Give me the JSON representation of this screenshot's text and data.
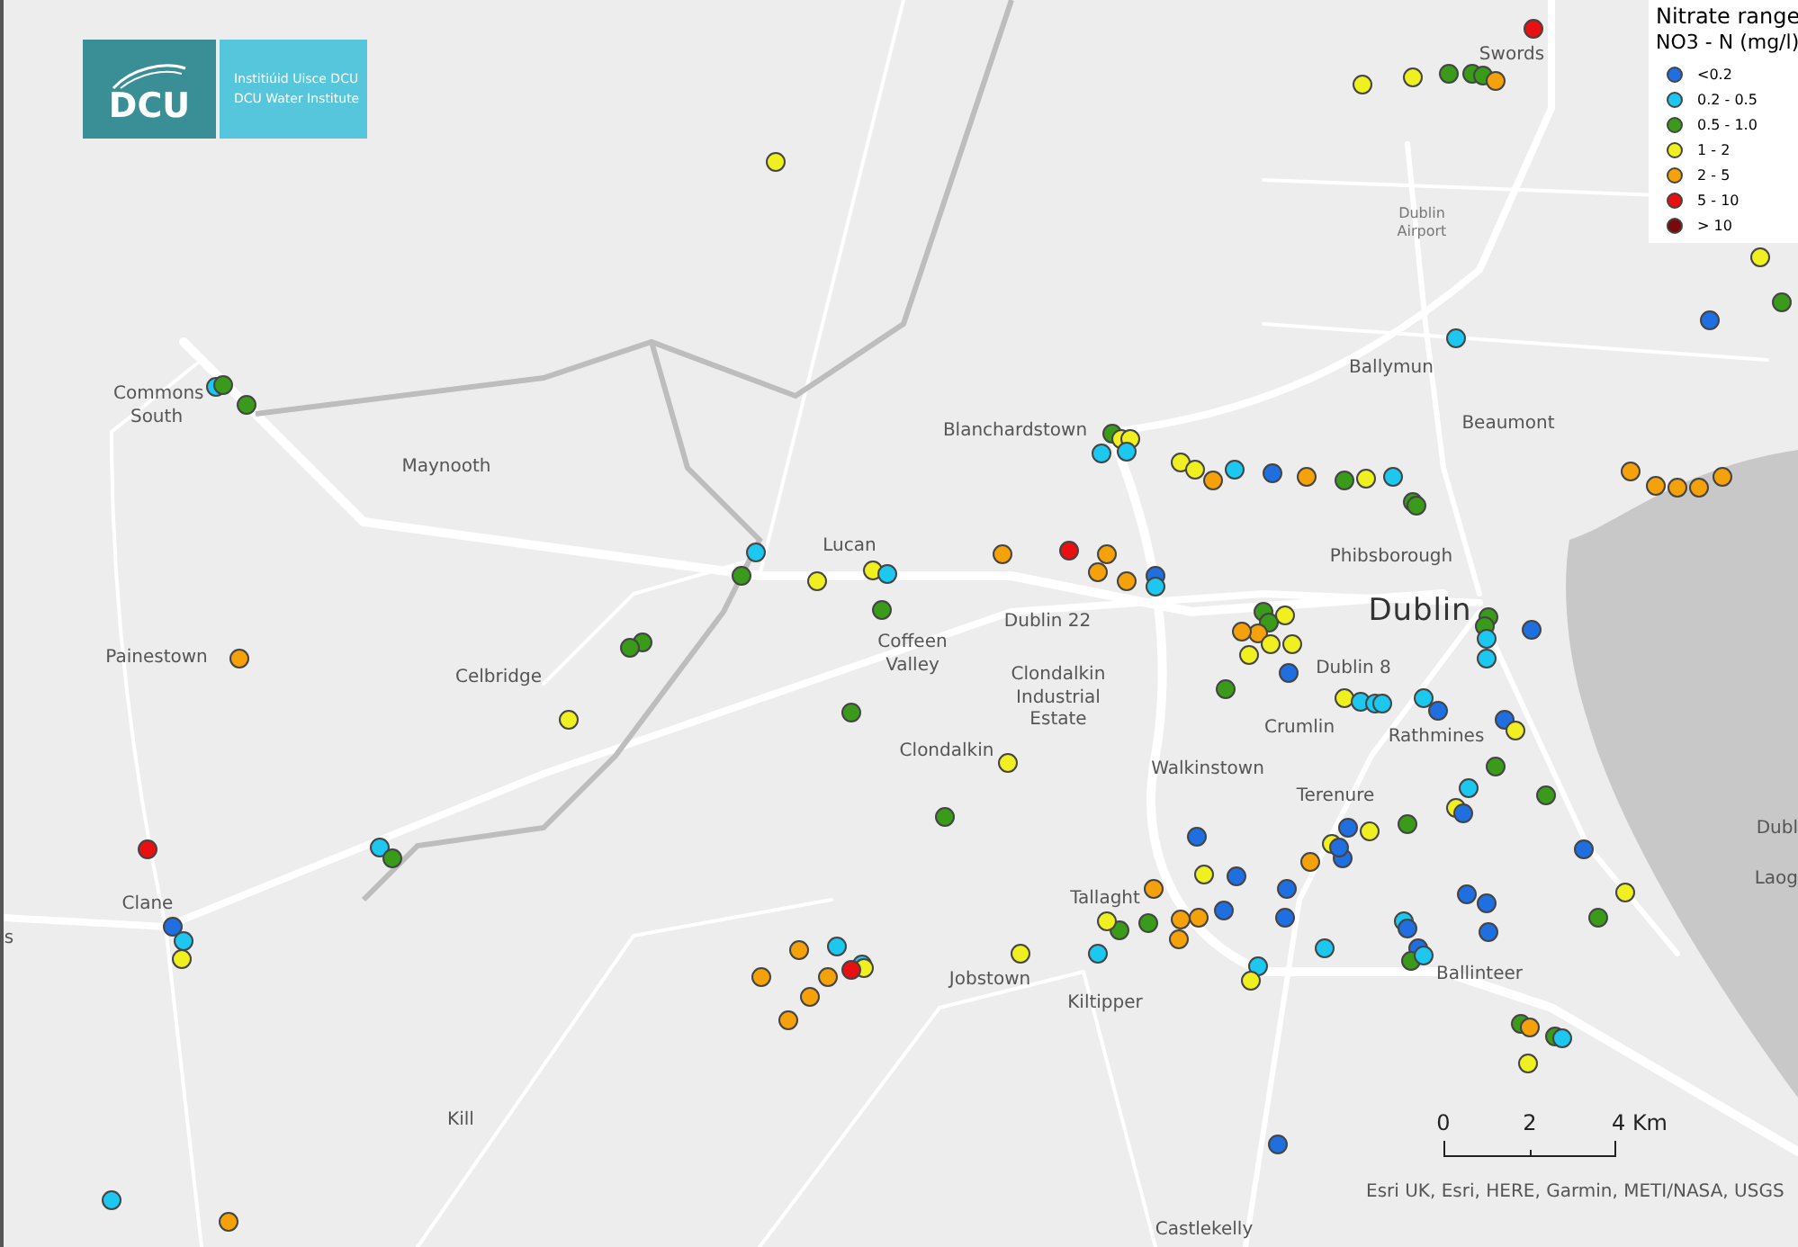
{
  "logo": {
    "mark": "DCU",
    "lines": [
      "Institiúid Uisce DCU",
      "DCU Water Institute"
    ]
  },
  "legend": {
    "title": "Nitrate range",
    "subtitle": "NO3 - N (mg/l)",
    "classes": [
      {
        "label": "<0.2",
        "color": "#1f6fe0"
      },
      {
        "label": "0.2 - 0.5",
        "color": "#1cc8f0"
      },
      {
        "label": "0.5 - 1.0",
        "color": "#3a9a1a"
      },
      {
        "label": "1 - 2",
        "color": "#f0f020"
      },
      {
        "label": "2 - 5",
        "color": "#f5a20a"
      },
      {
        "label": "5 - 10",
        "color": "#e81010"
      },
      {
        "label": "> 10",
        "color": "#7a0a0a"
      }
    ]
  },
  "places": [
    {
      "label": "Swords",
      "kind": "town"
    },
    {
      "label": "Dublin Airport",
      "kind": "airport"
    },
    {
      "label": "Ballymun",
      "kind": "town"
    },
    {
      "label": "Beaumont",
      "kind": "town"
    },
    {
      "label": "Commons South",
      "kind": "town"
    },
    {
      "label": "Maynooth",
      "kind": "town"
    },
    {
      "label": "Blanchardstown",
      "kind": "town"
    },
    {
      "label": "Phibsborough",
      "kind": "town"
    },
    {
      "label": "Lucan",
      "kind": "town"
    },
    {
      "label": "Dublin",
      "kind": "city"
    },
    {
      "label": "Dublin 22",
      "kind": "town"
    },
    {
      "label": "Dublin 8",
      "kind": "town"
    },
    {
      "label": "Painestown",
      "kind": "town"
    },
    {
      "label": "Celbridge",
      "kind": "town"
    },
    {
      "label": "Coffeen Valley",
      "kind": "town"
    },
    {
      "label": "Clondalkin Industrial Estate",
      "kind": "town"
    },
    {
      "label": "Crumlin",
      "kind": "town"
    },
    {
      "label": "Rathmines",
      "kind": "town"
    },
    {
      "label": "Clondalkin",
      "kind": "town"
    },
    {
      "label": "Walkinstown",
      "kind": "town"
    },
    {
      "label": "Terenure",
      "kind": "town"
    },
    {
      "label": "Clane",
      "kind": "town"
    },
    {
      "label": "s",
      "kind": "town"
    },
    {
      "label": "Tallaght",
      "kind": "town"
    },
    {
      "label": "Jobstown",
      "kind": "town"
    },
    {
      "label": "Kiltipper",
      "kind": "town"
    },
    {
      "label": "Ballinteer",
      "kind": "town"
    },
    {
      "label": "Kill",
      "kind": "town"
    },
    {
      "label": "Castlekelly",
      "kind": "town"
    },
    {
      "label": "Dubl",
      "kind": "town"
    },
    {
      "label": "Laog",
      "kind": "town"
    }
  ],
  "sites": [
    {
      "color": "#e81010"
    },
    {
      "color": "#f0f020"
    },
    {
      "color": "#f0f020"
    },
    {
      "color": "#3a9a1a"
    },
    {
      "color": "#3a9a1a"
    },
    {
      "color": "#3a9a1a"
    },
    {
      "color": "#f5a20a"
    },
    {
      "color": "#f0f020"
    },
    {
      "color": "#f0f020"
    },
    {
      "color": "#3a9a1a"
    },
    {
      "color": "#1f6fe0"
    },
    {
      "color": "#1cc8f0"
    },
    {
      "color": "#1cc8f0"
    },
    {
      "color": "#3a9a1a"
    },
    {
      "color": "#3a9a1a"
    },
    {
      "color": "#3a9a1a"
    },
    {
      "color": "#f0f020"
    },
    {
      "color": "#f0f020"
    },
    {
      "color": "#1cc8f0"
    },
    {
      "color": "#1cc8f0"
    },
    {
      "color": "#f0f020"
    },
    {
      "color": "#f0f020"
    },
    {
      "color": "#f5a20a"
    },
    {
      "color": "#1cc8f0"
    },
    {
      "color": "#1f6fe0"
    },
    {
      "color": "#f5a20a"
    },
    {
      "color": "#3a9a1a"
    },
    {
      "color": "#f0f020"
    },
    {
      "color": "#1cc8f0"
    },
    {
      "color": "#3a9a1a"
    },
    {
      "color": "#3a9a1a"
    },
    {
      "color": "#f5a20a"
    },
    {
      "color": "#f5a20a"
    },
    {
      "color": "#f5a20a"
    },
    {
      "color": "#f5a20a"
    },
    {
      "color": "#f5a20a"
    },
    {
      "color": "#1cc8f0"
    },
    {
      "color": "#3a9a1a"
    },
    {
      "color": "#f0f020"
    },
    {
      "color": "#f0f020"
    },
    {
      "color": "#1cc8f0"
    },
    {
      "color": "#3a9a1a"
    },
    {
      "color": "#f5a20a"
    },
    {
      "color": "#e81010"
    },
    {
      "color": "#f5a20a"
    },
    {
      "color": "#f5a20a"
    },
    {
      "color": "#f5a20a"
    },
    {
      "color": "#1f6fe0"
    },
    {
      "color": "#1cc8f0"
    },
    {
      "color": "#3a9a1a"
    },
    {
      "color": "#3a9a1a"
    },
    {
      "color": "#f0f020"
    },
    {
      "color": "#f5a20a"
    },
    {
      "color": "#f5a20a"
    },
    {
      "color": "#f0f020"
    },
    {
      "color": "#f0f020"
    },
    {
      "color": "#f0f020"
    },
    {
      "color": "#3a9a1a"
    },
    {
      "color": "#3a9a1a"
    },
    {
      "color": "#1cc8f0"
    },
    {
      "color": "#1f6fe0"
    },
    {
      "color": "#1cc8f0"
    },
    {
      "color": "#3a9a1a"
    },
    {
      "color": "#3a9a1a"
    },
    {
      "color": "#f5a20a"
    },
    {
      "color": "#3a9a1a"
    },
    {
      "color": "#1f6fe0"
    },
    {
      "color": "#f0f020"
    },
    {
      "color": "#1cc8f0"
    },
    {
      "color": "#1cc8f0"
    },
    {
      "color": "#1cc8f0"
    },
    {
      "color": "#1cc8f0"
    },
    {
      "color": "#1f6fe0"
    },
    {
      "color": "#1f6fe0"
    },
    {
      "color": "#f0f020"
    },
    {
      "color": "#3a9a1a"
    },
    {
      "color": "#f0f020"
    },
    {
      "color": "#3a9a1a"
    },
    {
      "color": "#f0f020"
    },
    {
      "color": "#1cc8f0"
    },
    {
      "color": "#f0f020"
    },
    {
      "color": "#3a9a1a"
    },
    {
      "color": "#1f6fe0"
    },
    {
      "color": "#3a9a1a"
    },
    {
      "color": "#1f6fe0"
    },
    {
      "color": "#f0f020"
    },
    {
      "color": "#f0f020"
    },
    {
      "color": "#1f6fe0"
    },
    {
      "color": "#1f6fe0"
    },
    {
      "color": "#f5a20a"
    },
    {
      "color": "#1f6fe0"
    },
    {
      "color": "#1f6fe0"
    },
    {
      "color": "#1f6fe0"
    },
    {
      "color": "#f0f020"
    },
    {
      "color": "#f5a20a"
    },
    {
      "color": "#3a9a1a"
    },
    {
      "color": "#1cc8f0"
    },
    {
      "color": "#3a9a1a"
    },
    {
      "color": "#e81010"
    },
    {
      "color": "#1f6fe0"
    },
    {
      "color": "#f0f020"
    },
    {
      "color": "#3a9a1a"
    },
    {
      "color": "#1f6fe0"
    },
    {
      "color": "#1f6fe0"
    },
    {
      "color": "#1f6fe0"
    },
    {
      "color": "#1cc8f0"
    },
    {
      "color": "#1f6fe0"
    },
    {
      "color": "#1f6fe0"
    },
    {
      "color": "#3a9a1a"
    },
    {
      "color": "#1cc8f0"
    },
    {
      "color": "#1f6fe0"
    },
    {
      "color": "#1f6fe0"
    },
    {
      "color": "#f5a20a"
    },
    {
      "color": "#f5a20a"
    },
    {
      "color": "#f5a20a"
    },
    {
      "color": "#3a9a1a"
    },
    {
      "color": "#f0f020"
    },
    {
      "color": "#3a9a1a"
    },
    {
      "color": "#1cc8f0"
    },
    {
      "color": "#f0f020"
    },
    {
      "color": "#1cc8f0"
    },
    {
      "color": "#f0f020"
    },
    {
      "color": "#1cc8f0"
    },
    {
      "color": "#f5a20a"
    },
    {
      "color": "#1cc8f0"
    },
    {
      "color": "#1cc8f0"
    },
    {
      "color": "#f0f020"
    },
    {
      "color": "#e81010"
    },
    {
      "color": "#f5a20a"
    },
    {
      "color": "#f5a20a"
    },
    {
      "color": "#f5a20a"
    },
    {
      "color": "#f5a20a"
    },
    {
      "color": "#1f6fe0"
    },
    {
      "color": "#1cc8f0"
    },
    {
      "color": "#f0f020"
    },
    {
      "color": "#3a9a1a"
    },
    {
      "color": "#f5a20a"
    },
    {
      "color": "#3a9a1a"
    },
    {
      "color": "#1cc8f0"
    },
    {
      "color": "#f0f020"
    },
    {
      "color": "#1f6fe0"
    },
    {
      "color": "#1cc8f0"
    },
    {
      "color": "#f5a20a"
    }
  ],
  "scale_bar": {
    "ticks": [
      "0",
      "2",
      "4 Km"
    ]
  },
  "attribution": "Esri UK, Esri, HERE, Garmin, METI/NASA, USGS"
}
